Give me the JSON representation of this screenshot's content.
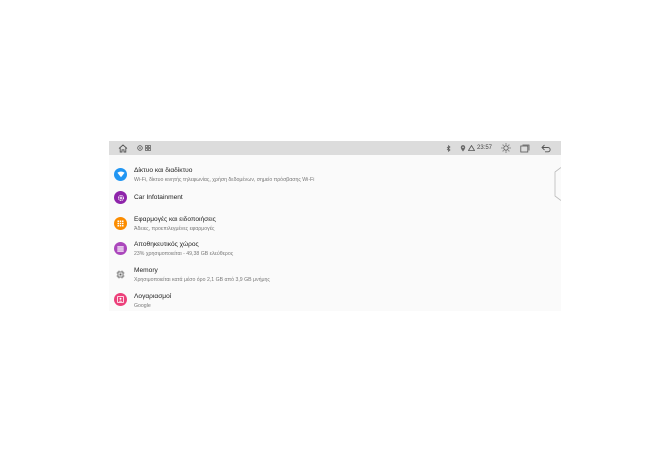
{
  "statusbar": {
    "home_icon": "home-icon",
    "left_icons": [
      "media-icon",
      "grid-icon"
    ],
    "right_icons": [
      "bluetooth-icon",
      "location-icon",
      "gps-icon"
    ],
    "time": "23:57",
    "brightness_icon": "brightness-icon",
    "recents_icon": "recents-icon",
    "back_icon": "back-icon"
  },
  "settings": [
    {
      "title": "Δίκτυο και διαδίκτυο",
      "subtitle": "Wi-Fi, δίκτυο κινητής τηλεφωνίας, χρήση δεδομένων, σημείο πρόσβασης Wi-Fi",
      "icon": "wifi-icon",
      "color": "#2196f3"
    },
    {
      "title": "Car Infotainment",
      "subtitle": "",
      "icon": "gear-icon",
      "color": "#8e24aa"
    },
    {
      "title": "Εφαρμογές και ειδοποιήσεις",
      "subtitle": "Άδειες, προεπιλεγμένες εφαρμογές",
      "icon": "apps-icon",
      "color": "#fb8c00"
    },
    {
      "title": "Αποθηκευτικός χώρος",
      "subtitle": "23% χρησιμοποιείται - 49,38 GB ελεύθερος",
      "icon": "storage-icon",
      "color": "#ab47bc"
    },
    {
      "title": "Memory",
      "subtitle": "Χρησιμοποιείται κατά μέσο όρο 2,1 GB από 3,9 GB μνήμης",
      "icon": "memory-icon",
      "color": "#757575"
    },
    {
      "title": "Λογαριασμοί",
      "subtitle": "Google",
      "icon": "account-icon",
      "color": "#ec407a"
    }
  ]
}
